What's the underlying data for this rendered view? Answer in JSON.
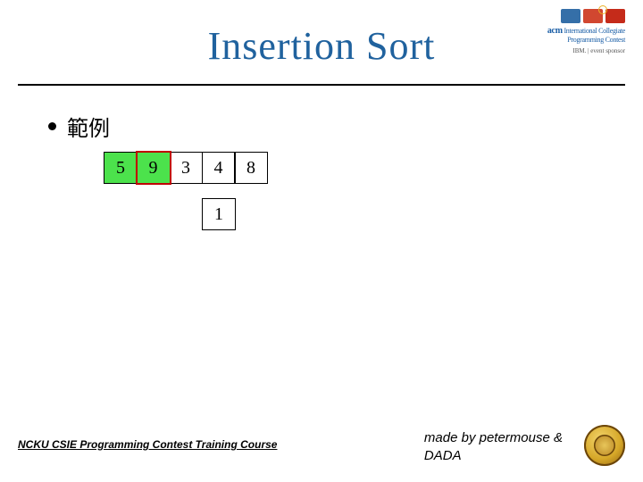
{
  "title": "Insertion Sort",
  "bullet": "範例",
  "array": {
    "cells": [
      {
        "value": "5",
        "green": true,
        "selected": false
      },
      {
        "value": "9",
        "green": true,
        "selected": true
      },
      {
        "value": "3",
        "green": false,
        "selected": false
      },
      {
        "value": "4",
        "green": false,
        "selected": false
      },
      {
        "value": "8",
        "green": false,
        "selected": false
      }
    ],
    "temp": "1"
  },
  "top_logo": {
    "acm_label": "acm",
    "contest_label": "International Collegiate Programming Contest",
    "sponsor": "IBM. | event sponsor"
  },
  "footer": {
    "course": "NCKU CSIE Programming Contest Training Course",
    "credit_line1": "made by petermouse &",
    "credit_line2": "DADA"
  }
}
